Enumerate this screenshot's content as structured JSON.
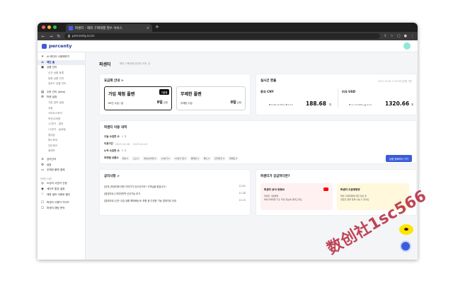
{
  "browser": {
    "tab_title": "퍼센티 - 해외 구매대행 필수 서비스",
    "url": "percenty.co.kr"
  },
  "app": {
    "logo": "percenty",
    "page_title": "퍼센티",
    "page_subtitle": "해외 구매대행 운영의 모든 것"
  },
  "sidebar": {
    "items": [
      {
        "label": "AI 에디터 사용해보기",
        "icon": "✦",
        "kind": "item"
      },
      {
        "label": "메인 홈",
        "icon": "⌂",
        "kind": "active"
      },
      {
        "label": "상품 관리",
        "icon": "▣",
        "kind": "item"
      },
      {
        "label": "신규 상품 등록",
        "icon": "",
        "kind": "sub"
      },
      {
        "label": "등록 상품 관리",
        "icon": "",
        "kind": "sub"
      },
      {
        "label": "업로드 상품 관리",
        "icon": "",
        "kind": "sub"
      },
      {
        "label": "",
        "icon": "",
        "kind": "gap"
      },
      {
        "label": "주문 관리 (beta)",
        "icon": "▤",
        "kind": "item"
      },
      {
        "label": "마켓 설정",
        "icon": "⚙",
        "kind": "item"
      },
      {
        "label": "기본 정보 설정",
        "icon": "",
        "kind": "sub"
      },
      {
        "label": "쿠팡",
        "icon": "",
        "kind": "sub"
      },
      {
        "label": "스마트스토어",
        "icon": "",
        "kind": "sub"
      },
      {
        "label": "옥션/G마켓",
        "icon": "",
        "kind": "sub"
      },
      {
        "label": "11번가 - 일반",
        "icon": "",
        "kind": "sub"
      },
      {
        "label": "11번가 - 글로벌",
        "icon": "",
        "kind": "sub"
      },
      {
        "label": "롯데온",
        "icon": "",
        "kind": "sub"
      },
      {
        "label": "톡스토어",
        "icon": "",
        "kind": "sub"
      },
      {
        "label": "인터파크",
        "icon": "",
        "kind": "sub"
      },
      {
        "label": "위메프",
        "icon": "",
        "kind": "sub"
      },
      {
        "label": "",
        "icon": "",
        "kind": "gap"
      },
      {
        "label": "금지단어",
        "icon": "⊘",
        "kind": "item"
      },
      {
        "label": "설정",
        "icon": "⚙",
        "kind": "item"
      },
      {
        "label": "무제한 플랜 결제",
        "icon": "▭",
        "kind": "item"
      },
      {
        "label": "",
        "icon": "",
        "kind": "gap"
      },
      {
        "label": "판매자 지원",
        "icon": "",
        "kind": "section"
      },
      {
        "label": "소싱처 사업자 신청",
        "icon": "◎",
        "kind": "item"
      },
      {
        "label": "세이프 통장 설정",
        "icon": "◉",
        "kind": "item"
      },
      {
        "label": "제휴 셀러 이용료 할인",
        "icon": "♡",
        "kind": "item"
      },
      {
        "label": "",
        "icon": "",
        "kind": "gap"
      },
      {
        "label": "퍼센티 사용자 가이드",
        "icon": "☐",
        "kind": "item"
      },
      {
        "label": "퍼센티 채팅 문의",
        "icon": "☐",
        "kind": "item"
      }
    ]
  },
  "plan": {
    "title": "요금제 안내 >",
    "trial": {
      "name": "가입 체험 플랜",
      "desc": "60단 수집 / 일",
      "days": "9일",
      "days_unit": "남음",
      "badge": "이용중"
    },
    "unlimited": {
      "name": "무제한 플랜",
      "desc": "무제한 수집",
      "days": "0일",
      "days_unit": "남음"
    }
  },
  "rates": {
    "title": "실시간 환율",
    "date": "2023.10.06 17:00 하나은행 기준",
    "cny": {
      "label": "중국 CNY",
      "change": "▼ 0.08 (0.05%) ▼ 0.13",
      "value": "188.68",
      "unit": "원"
    },
    "usd": {
      "label": "미국 USD",
      "change": "▼ 1.1 (0.08%) ▲ 0.14",
      "value": "1320.66",
      "unit": "원"
    }
  },
  "usage": {
    "title": "퍼센티 이용 내역",
    "rows": [
      {
        "label": "오늘 수집한 수",
        "value": "0 개"
      },
      {
        "label": "이용기간",
        "value": "2023.10.06 ~ 2023.10.15"
      },
      {
        "label": "누적 수집한 수",
        "value": "0 개"
      }
    ],
    "market_label": "마켓별 상품수",
    "markets": [
      "쿠팡 0",
      "스스 0",
      "옥션/G마켓 0",
      "11번가 0",
      "11번가 글 0",
      "롯데온 0",
      "톡스 0",
      "인터파크 0",
      "위메프 0"
    ],
    "cta": "상품 등록하러 가기"
  },
  "notice": {
    "title": "공지사항 >",
    "rows": [
      {
        "text": "[공지] 퍼센티에 관한 이야기가 있으신가요? 고객님을 찾습니다!",
        "date": "12.01"
      },
      {
        "text": "[업데이트] 이미지번역 신규기능 추가",
        "date": "11.28"
      },
      {
        "text": "[업데이트] 신규 수집 상품 해외배송 비 포함 등 다양한 기능 업데이트 안내",
        "date": "11.15"
      }
    ]
  },
  "promo": {
    "title": "퍼센티가 궁금하다면?",
    "youtube": {
      "title": "퍼센티 공식 유튜브",
      "lines": [
        "퍼센티 사용방법",
        "해외구매대행 기초 학습 정보를 알려드려요."
      ]
    },
    "open_chat": {
      "title": "퍼센티 오픈채팅방",
      "lines": [
        "해외 구매대행에 대한 정보 및",
        "궁금한 점을 함께 나눌 수 있어요"
      ]
    }
  },
  "watermark": "数创社1sc566",
  "colors": {
    "accent": "#3b5bdb",
    "dark": "#111111",
    "kakao": "#fee500"
  }
}
